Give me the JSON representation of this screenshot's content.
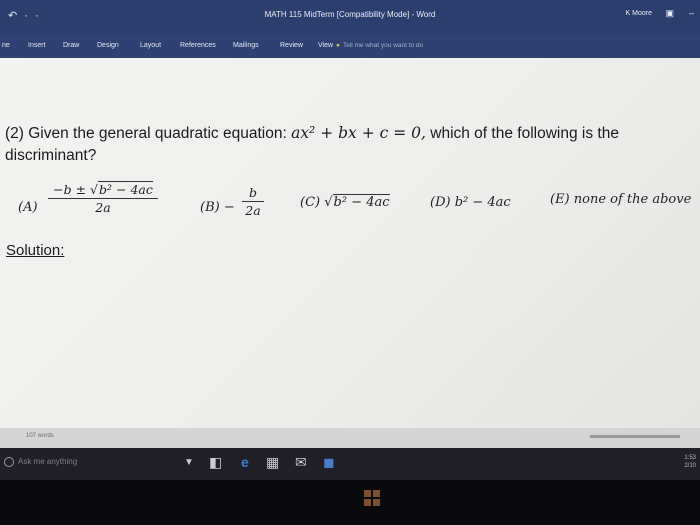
{
  "window": {
    "title": "MATH 115 MidTerm [Compatibility Mode]  -  Word",
    "user": "K Moore",
    "quick_access": "↶ · ·"
  },
  "ribbon": {
    "tabs": [
      "ne",
      "Insert",
      "Draw",
      "Design",
      "Layout",
      "References",
      "Mailings",
      "Review",
      "View"
    ],
    "tell_me_placeholder": "Tell me what you want to do"
  },
  "document": {
    "question_line1_prefix": "(2)  Given the general quadratic equation:",
    "equation": "ax² + bx + c = 0,",
    "question_line1_suffix": "which of the following is the",
    "question_line2": "discriminant?",
    "options": {
      "A": {
        "label": "(A)",
        "numerator_lead": "−b ± √",
        "radicand": "b² − 4ac",
        "denominator": "2a"
      },
      "B": {
        "label": "(B) −",
        "numerator": "b",
        "denominator": "2a"
      },
      "C": {
        "label": "(C) √",
        "radicand": "b² − 4ac"
      },
      "D": {
        "text": "(D) b² − 4ac"
      },
      "E": {
        "text": "(E) none of the above"
      }
    },
    "solution_label": "Solution:"
  },
  "statusbar": {
    "word_count": "107 words"
  },
  "taskbar": {
    "search_placeholder": "Ask me anything",
    "clock_time": "1:53",
    "clock_date": "2/10"
  }
}
